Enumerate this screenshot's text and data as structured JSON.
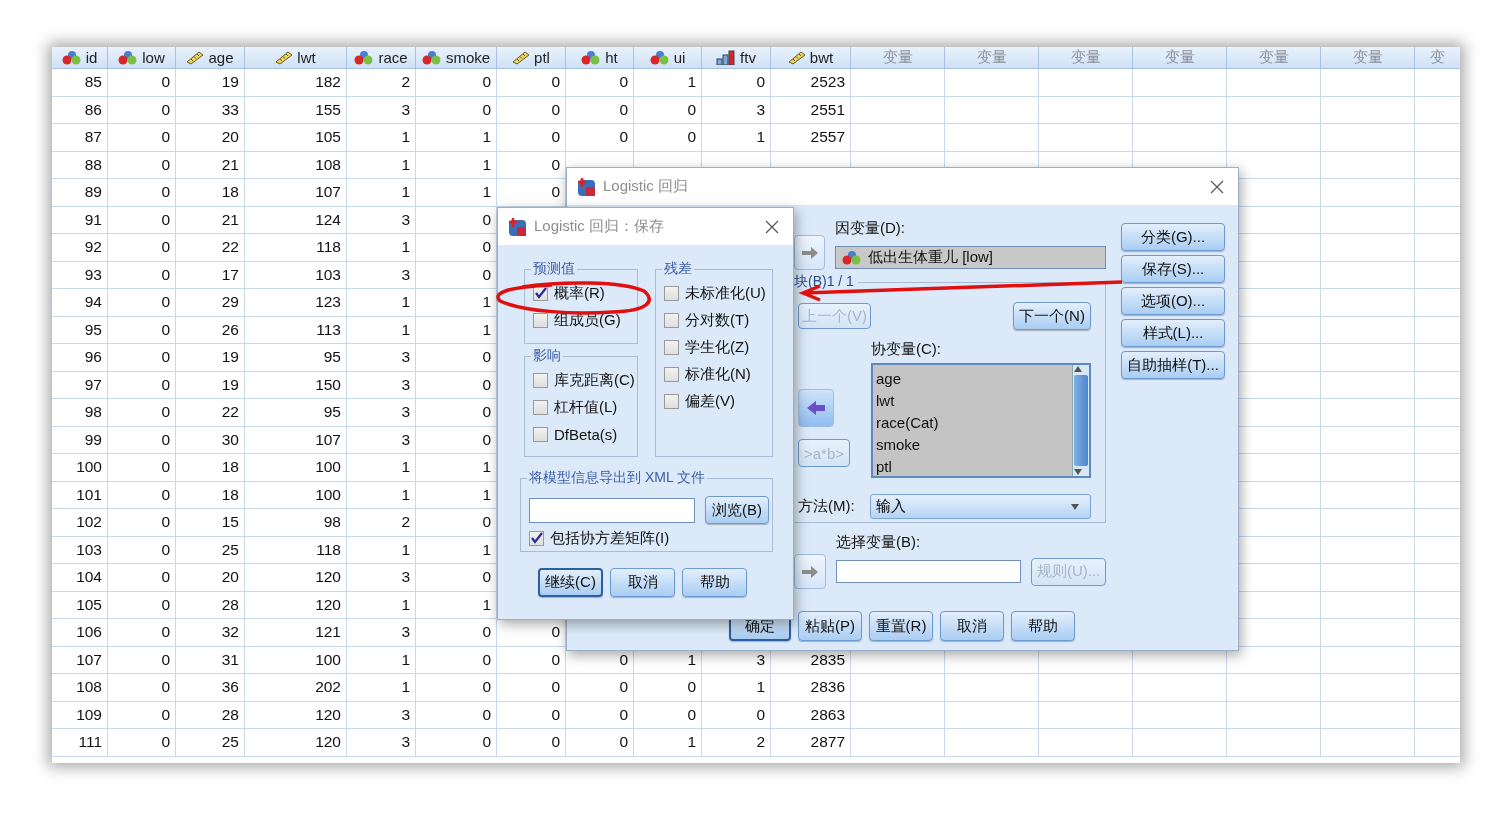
{
  "data_view": {
    "columns": [
      {
        "name": "id",
        "kind": "nominal"
      },
      {
        "name": "low",
        "kind": "nominal"
      },
      {
        "name": "age",
        "kind": "scale"
      },
      {
        "name": "lwt",
        "kind": "scale"
      },
      {
        "name": "race",
        "kind": "nominal"
      },
      {
        "name": "smoke",
        "kind": "nominal"
      },
      {
        "name": "ptl",
        "kind": "scale"
      },
      {
        "name": "ht",
        "kind": "nominal"
      },
      {
        "name": "ui",
        "kind": "nominal"
      },
      {
        "name": "ftv",
        "kind": "ordinal"
      },
      {
        "name": "bwt",
        "kind": "scale"
      },
      {
        "name": "变量",
        "kind": "empty"
      },
      {
        "name": "变量",
        "kind": "empty"
      },
      {
        "name": "变量",
        "kind": "empty"
      },
      {
        "name": "变量",
        "kind": "empty"
      },
      {
        "name": "变量",
        "kind": "empty"
      },
      {
        "name": "变量",
        "kind": "empty"
      },
      {
        "name": "变",
        "kind": "empty"
      }
    ],
    "rows": [
      [
        "85",
        "0",
        "19",
        "182",
        "2",
        "0",
        "0",
        "0",
        "1",
        "0",
        "2523"
      ],
      [
        "86",
        "0",
        "33",
        "155",
        "3",
        "0",
        "0",
        "0",
        "0",
        "3",
        "2551"
      ],
      [
        "87",
        "0",
        "20",
        "105",
        "1",
        "1",
        "0",
        "0",
        "0",
        "1",
        "2557"
      ],
      [
        "88",
        "0",
        "21",
        "108",
        "1",
        "1",
        "0",
        null,
        null,
        null,
        null
      ],
      [
        "89",
        "0",
        "18",
        "107",
        "1",
        "1",
        "0",
        null,
        null,
        null,
        null
      ],
      [
        "91",
        "0",
        "21",
        "124",
        "3",
        "0",
        null,
        null,
        null,
        null,
        null
      ],
      [
        "92",
        "0",
        "22",
        "118",
        "1",
        "0",
        null,
        null,
        null,
        null,
        null
      ],
      [
        "93",
        "0",
        "17",
        "103",
        "3",
        "0",
        null,
        null,
        null,
        null,
        null
      ],
      [
        "94",
        "0",
        "29",
        "123",
        "1",
        "1",
        null,
        null,
        null,
        null,
        null
      ],
      [
        "95",
        "0",
        "26",
        "113",
        "1",
        "1",
        null,
        null,
        null,
        null,
        null
      ],
      [
        "96",
        "0",
        "19",
        "95",
        "3",
        "0",
        null,
        null,
        null,
        null,
        null
      ],
      [
        "97",
        "0",
        "19",
        "150",
        "3",
        "0",
        null,
        null,
        null,
        null,
        null
      ],
      [
        "98",
        "0",
        "22",
        "95",
        "3",
        "0",
        null,
        null,
        null,
        null,
        null
      ],
      [
        "99",
        "0",
        "30",
        "107",
        "3",
        "0",
        null,
        null,
        null,
        null,
        null
      ],
      [
        "100",
        "0",
        "18",
        "100",
        "1",
        "1",
        null,
        null,
        null,
        null,
        null
      ],
      [
        "101",
        "0",
        "18",
        "100",
        "1",
        "1",
        null,
        null,
        null,
        null,
        null
      ],
      [
        "102",
        "0",
        "15",
        "98",
        "2",
        "0",
        null,
        null,
        null,
        null,
        null
      ],
      [
        "103",
        "0",
        "25",
        "118",
        "1",
        "1",
        null,
        null,
        null,
        null,
        null
      ],
      [
        "104",
        "0",
        "20",
        "120",
        "3",
        "0",
        null,
        null,
        null,
        null,
        null
      ],
      [
        "105",
        "0",
        "28",
        "120",
        "1",
        "1",
        null,
        null,
        null,
        null,
        null
      ],
      [
        "106",
        "0",
        "32",
        "121",
        "3",
        "0",
        "0",
        null,
        null,
        null,
        null
      ],
      [
        "107",
        "0",
        "31",
        "100",
        "1",
        "0",
        "0",
        "0",
        "1",
        "3",
        "2835"
      ],
      [
        "108",
        "0",
        "36",
        "202",
        "1",
        "0",
        "0",
        "0",
        "0",
        "1",
        "2836"
      ],
      [
        "109",
        "0",
        "28",
        "120",
        "3",
        "0",
        "0",
        "0",
        "0",
        "0",
        "2863"
      ],
      [
        "111",
        "0",
        "25",
        "120",
        "3",
        "0",
        "0",
        "0",
        "1",
        "2",
        "2877"
      ]
    ]
  },
  "main_dialog": {
    "title": "Logistic 回归",
    "dependent": {
      "label": "因变量(D):",
      "value": "低出生体重儿 [low]"
    },
    "block": {
      "label": "块(B)1 / 1",
      "previous": {
        "label": "上一个(V)",
        "disabled": true
      },
      "next": {
        "label": "下一个(N)",
        "disabled": false
      },
      "covariates_label": "协变量(C):",
      "covariates": [
        "age",
        "lwt",
        "race(Cat)",
        "smoke",
        "ptl"
      ],
      "interaction": {
        "label": ">a*b>",
        "disabled": true
      },
      "method_label": "方法(M):",
      "method": "输入"
    },
    "selection": {
      "label": "选择变量(B):",
      "rule": {
        "label": "规则(U)...",
        "disabled": true
      }
    },
    "side_buttons": [
      "分类(G)...",
      "保存(S)...",
      "选项(O)...",
      "样式(L)...",
      "自助抽样(T)..."
    ],
    "buttons": [
      {
        "label": "确定",
        "focused": true
      },
      {
        "label": "粘贴(P)",
        "focused": false
      },
      {
        "label": "重置(R)",
        "focused": false
      },
      {
        "label": "取消",
        "focused": false
      },
      {
        "label": "帮助",
        "focused": false
      }
    ]
  },
  "save_dialog": {
    "title": "Logistic 回归：保存",
    "groups": [
      {
        "title": "预测值",
        "items": [
          {
            "label": "概率(R)",
            "checked": true
          },
          {
            "label": "组成员(G)",
            "checked": false
          }
        ]
      },
      {
        "title": "影响",
        "items": [
          {
            "label": "库克距离(C)",
            "checked": false
          },
          {
            "label": "杠杆值(L)",
            "checked": false
          },
          {
            "label": "DfBeta(s)",
            "checked": false
          }
        ]
      },
      {
        "title": "残差",
        "items": [
          {
            "label": "未标准化(U)",
            "checked": false
          },
          {
            "label": "分对数(T)",
            "checked": false
          },
          {
            "label": "学生化(Z)",
            "checked": false
          },
          {
            "label": "标准化(N)",
            "checked": false
          },
          {
            "label": "偏差(V)",
            "checked": false
          }
        ]
      }
    ],
    "export": {
      "title": "将模型信息导出到 XML 文件",
      "browse": "浏览(B)",
      "covariance": {
        "label": "包括协方差矩阵(I)",
        "checked": true
      }
    },
    "buttons": [
      {
        "label": "继续(C)",
        "focused": true
      },
      {
        "label": "取消",
        "focused": false
      },
      {
        "label": "帮助",
        "focused": false
      }
    ]
  }
}
